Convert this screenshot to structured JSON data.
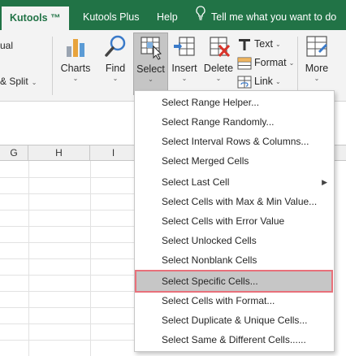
{
  "tabs": [
    {
      "label": "Kutools ™"
    },
    {
      "label": "Kutools Plus"
    },
    {
      "label": "Help"
    }
  ],
  "tell_me": {
    "text": "Tell me what you want to do"
  },
  "ribbon": {
    "fragment_top": "ual",
    "fragment_bottom": "& Split",
    "buttons": {
      "charts": "Charts",
      "find": "Find",
      "select": "Select",
      "insert": "Insert",
      "delete": "Delete",
      "more": "More"
    },
    "small": {
      "text": "Text",
      "format": "Format",
      "link": "Link"
    }
  },
  "columns": [
    "G",
    "H",
    "I"
  ],
  "select_menu": {
    "items": [
      {
        "label": "Select Range Helper..."
      },
      {
        "label": "Select Range Randomly..."
      },
      {
        "label": "Select Interval Rows & Columns..."
      },
      {
        "label": "Select Merged Cells"
      },
      {
        "label": "Select Last Cell"
      },
      {
        "label": "Select Cells with Max & Min Value..."
      },
      {
        "label": "Select Cells with Error Value"
      },
      {
        "label": "Select Unlocked Cells"
      },
      {
        "label": "Select Nonblank Cells"
      },
      {
        "label": "Select Specific Cells..."
      },
      {
        "label": "Select Cells with Format..."
      },
      {
        "label": "Select Duplicate & Unique Cells..."
      },
      {
        "label": "Select Same & Different Cells......"
      }
    ],
    "highlighted": "Select Specific Cells..."
  },
  "colors": {
    "tabbar": "#217346",
    "ribbon": "#f3f3f3",
    "highlight_border": "#e8707a"
  }
}
